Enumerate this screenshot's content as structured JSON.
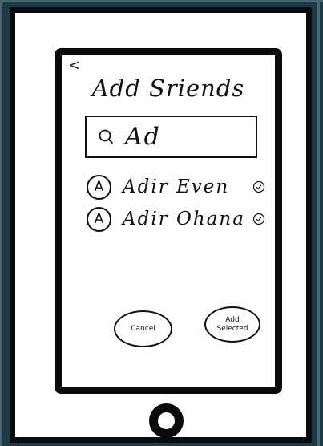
{
  "screen": {
    "back_label": "<",
    "title": "Add Sriends",
    "search": {
      "value": "Ad",
      "icon": "search-icon"
    },
    "results": [
      {
        "avatar": "A",
        "name": "Adir Even",
        "icon": "check-circle-icon"
      },
      {
        "avatar": "A",
        "name": "Adir Ohana",
        "icon": "check-circle-icon"
      }
    ],
    "cancel_label": "Cancel",
    "add_selected_line1": "Add",
    "add_selected_line2": "Selected"
  },
  "colors": {
    "ink": "#111111",
    "frame": "#0b0b0b",
    "background": "#1e3a47"
  }
}
